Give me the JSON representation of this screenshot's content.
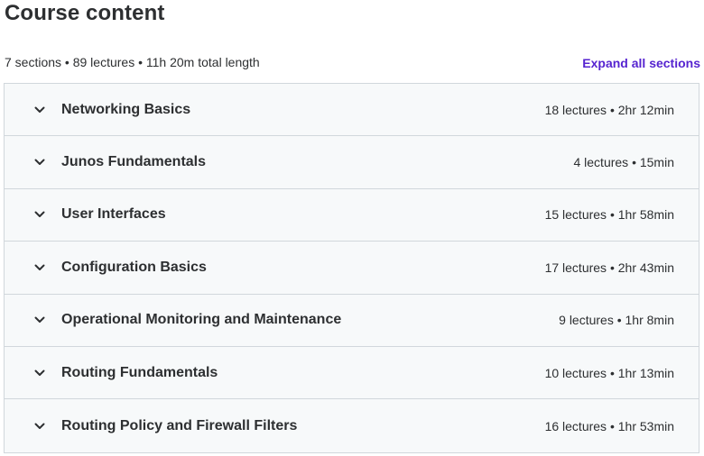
{
  "header": {
    "title": "Course content",
    "summary": "7 sections • 89 lectures • 11h 20m total length",
    "expand_all_label": "Expand all sections"
  },
  "icons": {
    "section_toggle": "chevron-down-icon"
  },
  "colors": {
    "link": "#5624d0",
    "section_bg": "#f7f9fa",
    "border": "#d1d7dc",
    "text": "#2d2f31"
  },
  "sections": [
    {
      "title": "Networking Basics",
      "meta": "18 lectures • 2hr 12min"
    },
    {
      "title": "Junos Fundamentals",
      "meta": "4 lectures • 15min"
    },
    {
      "title": "User Interfaces",
      "meta": "15 lectures • 1hr 58min"
    },
    {
      "title": "Configuration Basics",
      "meta": "17 lectures • 2hr 43min"
    },
    {
      "title": "Operational Monitoring and Maintenance",
      "meta": "9 lectures • 1hr 8min"
    },
    {
      "title": "Routing Fundamentals",
      "meta": "10 lectures • 1hr 13min"
    },
    {
      "title": "Routing Policy and Firewall Filters",
      "meta": "16 lectures • 1hr 53min"
    }
  ]
}
